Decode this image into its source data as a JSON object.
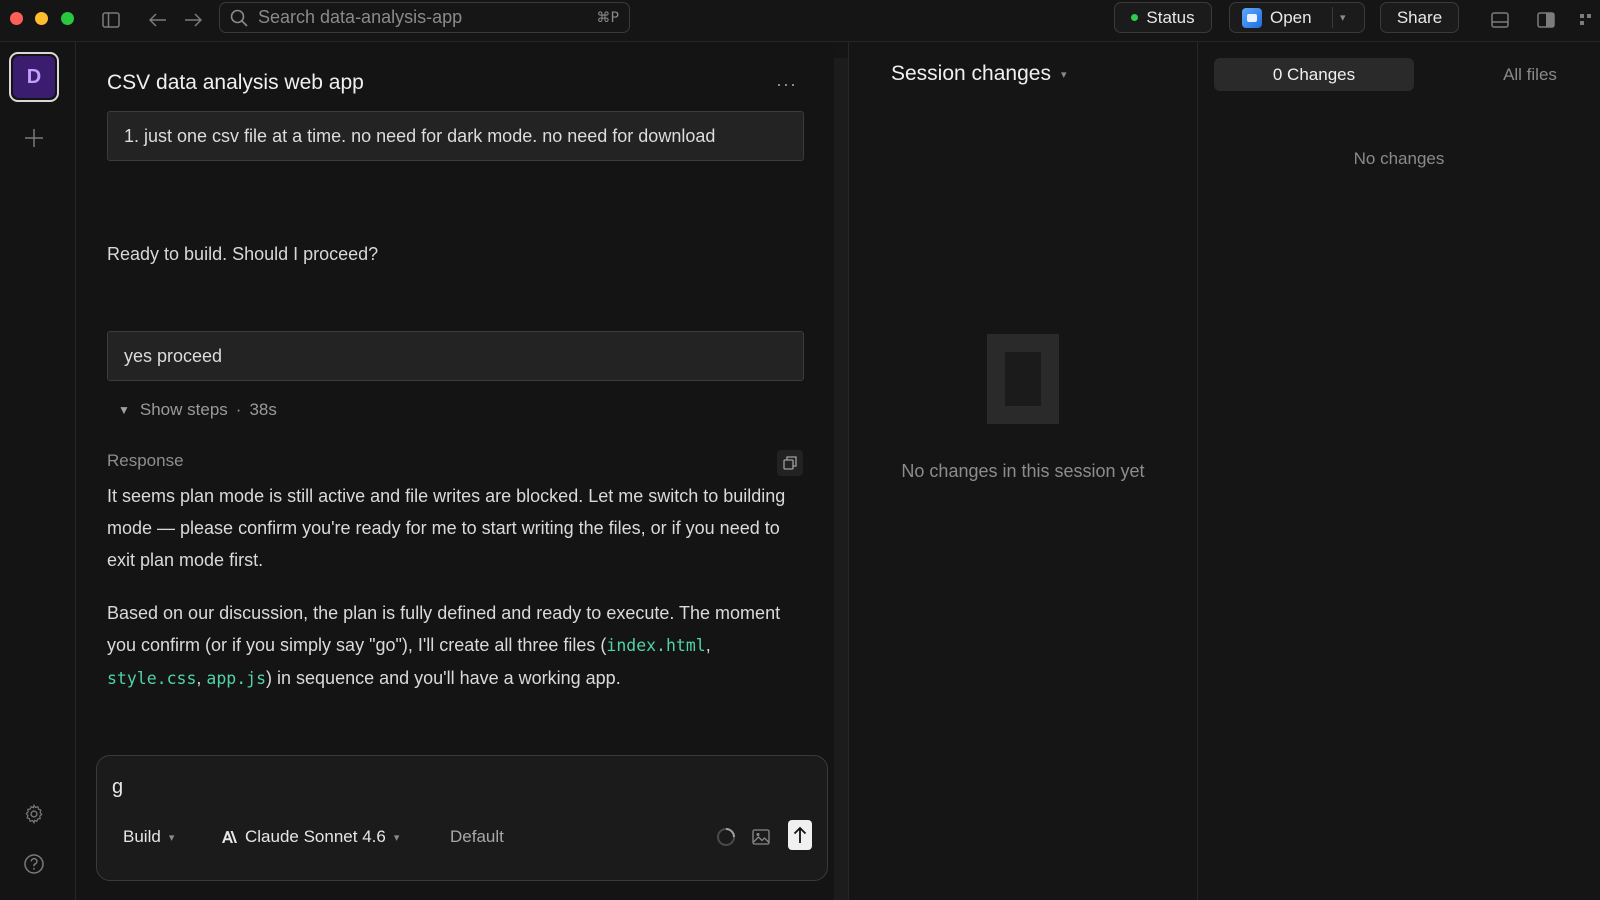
{
  "titlebar": {
    "search_placeholder": "Search data-analysis-app",
    "search_shortcut": "⌘P",
    "status_label": "Status",
    "open_label": "Open",
    "share_label": "Share"
  },
  "rail": {
    "workspace_initial": "D"
  },
  "chat": {
    "title": "CSV data analysis web app",
    "more_label": "···",
    "user_message_1": "1. just one csv file at a time. no need for dark mode. no need for download",
    "assistant_question": "Ready to build. Should I proceed?",
    "user_message_2": "yes proceed",
    "show_steps_label": "Show steps",
    "steps_separator": "·",
    "steps_duration": "38s",
    "response_label": "Response",
    "response_p1": "It seems plan mode is still active and file writes are blocked. Let me switch to building mode — please confirm you're ready for me to start writing the files, or if you need to exit plan mode first.",
    "response_p2_before": "Based on our discussion, the plan is fully defined and ready to execute. The moment you confirm (or if you simply say \"go\"), I'll create all three files (",
    "file_1": "index.html",
    "file_2": "style.css",
    "file_3": "app.js",
    "sep_comma": ", ",
    "response_p2_after": ") in sequence and you'll have a working app."
  },
  "composer": {
    "input_value": "g",
    "mode_label": "Build",
    "model_label": "Claude Sonnet 4.6",
    "variant_label": "Default"
  },
  "session": {
    "title": "Session changes",
    "empty_text": "No changes in this session yet"
  },
  "files": {
    "changes_tab": "0 Changes",
    "all_files_tab": "All files",
    "empty_text": "No changes"
  },
  "colors": {
    "accent_code": "#4fd4a8",
    "status_green": "#2ecc52",
    "avatar_bg": "#3a1d6e"
  }
}
